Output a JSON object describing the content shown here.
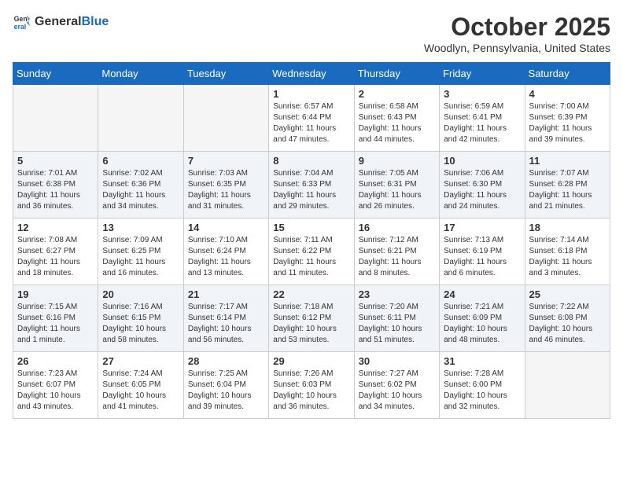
{
  "header": {
    "logo_general": "General",
    "logo_blue": "Blue",
    "month_title": "October 2025",
    "location": "Woodlyn, Pennsylvania, United States"
  },
  "weekdays": [
    "Sunday",
    "Monday",
    "Tuesday",
    "Wednesday",
    "Thursday",
    "Friday",
    "Saturday"
  ],
  "weeks": [
    [
      {
        "day": "",
        "content": ""
      },
      {
        "day": "",
        "content": ""
      },
      {
        "day": "",
        "content": ""
      },
      {
        "day": "1",
        "content": "Sunrise: 6:57 AM\nSunset: 6:44 PM\nDaylight: 11 hours\nand 47 minutes."
      },
      {
        "day": "2",
        "content": "Sunrise: 6:58 AM\nSunset: 6:43 PM\nDaylight: 11 hours\nand 44 minutes."
      },
      {
        "day": "3",
        "content": "Sunrise: 6:59 AM\nSunset: 6:41 PM\nDaylight: 11 hours\nand 42 minutes."
      },
      {
        "day": "4",
        "content": "Sunrise: 7:00 AM\nSunset: 6:39 PM\nDaylight: 11 hours\nand 39 minutes."
      }
    ],
    [
      {
        "day": "5",
        "content": "Sunrise: 7:01 AM\nSunset: 6:38 PM\nDaylight: 11 hours\nand 36 minutes."
      },
      {
        "day": "6",
        "content": "Sunrise: 7:02 AM\nSunset: 6:36 PM\nDaylight: 11 hours\nand 34 minutes."
      },
      {
        "day": "7",
        "content": "Sunrise: 7:03 AM\nSunset: 6:35 PM\nDaylight: 11 hours\nand 31 minutes."
      },
      {
        "day": "8",
        "content": "Sunrise: 7:04 AM\nSunset: 6:33 PM\nDaylight: 11 hours\nand 29 minutes."
      },
      {
        "day": "9",
        "content": "Sunrise: 7:05 AM\nSunset: 6:31 PM\nDaylight: 11 hours\nand 26 minutes."
      },
      {
        "day": "10",
        "content": "Sunrise: 7:06 AM\nSunset: 6:30 PM\nDaylight: 11 hours\nand 24 minutes."
      },
      {
        "day": "11",
        "content": "Sunrise: 7:07 AM\nSunset: 6:28 PM\nDaylight: 11 hours\nand 21 minutes."
      }
    ],
    [
      {
        "day": "12",
        "content": "Sunrise: 7:08 AM\nSunset: 6:27 PM\nDaylight: 11 hours\nand 18 minutes."
      },
      {
        "day": "13",
        "content": "Sunrise: 7:09 AM\nSunset: 6:25 PM\nDaylight: 11 hours\nand 16 minutes."
      },
      {
        "day": "14",
        "content": "Sunrise: 7:10 AM\nSunset: 6:24 PM\nDaylight: 11 hours\nand 13 minutes."
      },
      {
        "day": "15",
        "content": "Sunrise: 7:11 AM\nSunset: 6:22 PM\nDaylight: 11 hours\nand 11 minutes."
      },
      {
        "day": "16",
        "content": "Sunrise: 7:12 AM\nSunset: 6:21 PM\nDaylight: 11 hours\nand 8 minutes."
      },
      {
        "day": "17",
        "content": "Sunrise: 7:13 AM\nSunset: 6:19 PM\nDaylight: 11 hours\nand 6 minutes."
      },
      {
        "day": "18",
        "content": "Sunrise: 7:14 AM\nSunset: 6:18 PM\nDaylight: 11 hours\nand 3 minutes."
      }
    ],
    [
      {
        "day": "19",
        "content": "Sunrise: 7:15 AM\nSunset: 6:16 PM\nDaylight: 11 hours\nand 1 minute."
      },
      {
        "day": "20",
        "content": "Sunrise: 7:16 AM\nSunset: 6:15 PM\nDaylight: 10 hours\nand 58 minutes."
      },
      {
        "day": "21",
        "content": "Sunrise: 7:17 AM\nSunset: 6:14 PM\nDaylight: 10 hours\nand 56 minutes."
      },
      {
        "day": "22",
        "content": "Sunrise: 7:18 AM\nSunset: 6:12 PM\nDaylight: 10 hours\nand 53 minutes."
      },
      {
        "day": "23",
        "content": "Sunrise: 7:20 AM\nSunset: 6:11 PM\nDaylight: 10 hours\nand 51 minutes."
      },
      {
        "day": "24",
        "content": "Sunrise: 7:21 AM\nSunset: 6:09 PM\nDaylight: 10 hours\nand 48 minutes."
      },
      {
        "day": "25",
        "content": "Sunrise: 7:22 AM\nSunset: 6:08 PM\nDaylight: 10 hours\nand 46 minutes."
      }
    ],
    [
      {
        "day": "26",
        "content": "Sunrise: 7:23 AM\nSunset: 6:07 PM\nDaylight: 10 hours\nand 43 minutes."
      },
      {
        "day": "27",
        "content": "Sunrise: 7:24 AM\nSunset: 6:05 PM\nDaylight: 10 hours\nand 41 minutes."
      },
      {
        "day": "28",
        "content": "Sunrise: 7:25 AM\nSunset: 6:04 PM\nDaylight: 10 hours\nand 39 minutes."
      },
      {
        "day": "29",
        "content": "Sunrise: 7:26 AM\nSunset: 6:03 PM\nDaylight: 10 hours\nand 36 minutes."
      },
      {
        "day": "30",
        "content": "Sunrise: 7:27 AM\nSunset: 6:02 PM\nDaylight: 10 hours\nand 34 minutes."
      },
      {
        "day": "31",
        "content": "Sunrise: 7:28 AM\nSunset: 6:00 PM\nDaylight: 10 hours\nand 32 minutes."
      },
      {
        "day": "",
        "content": ""
      }
    ]
  ]
}
